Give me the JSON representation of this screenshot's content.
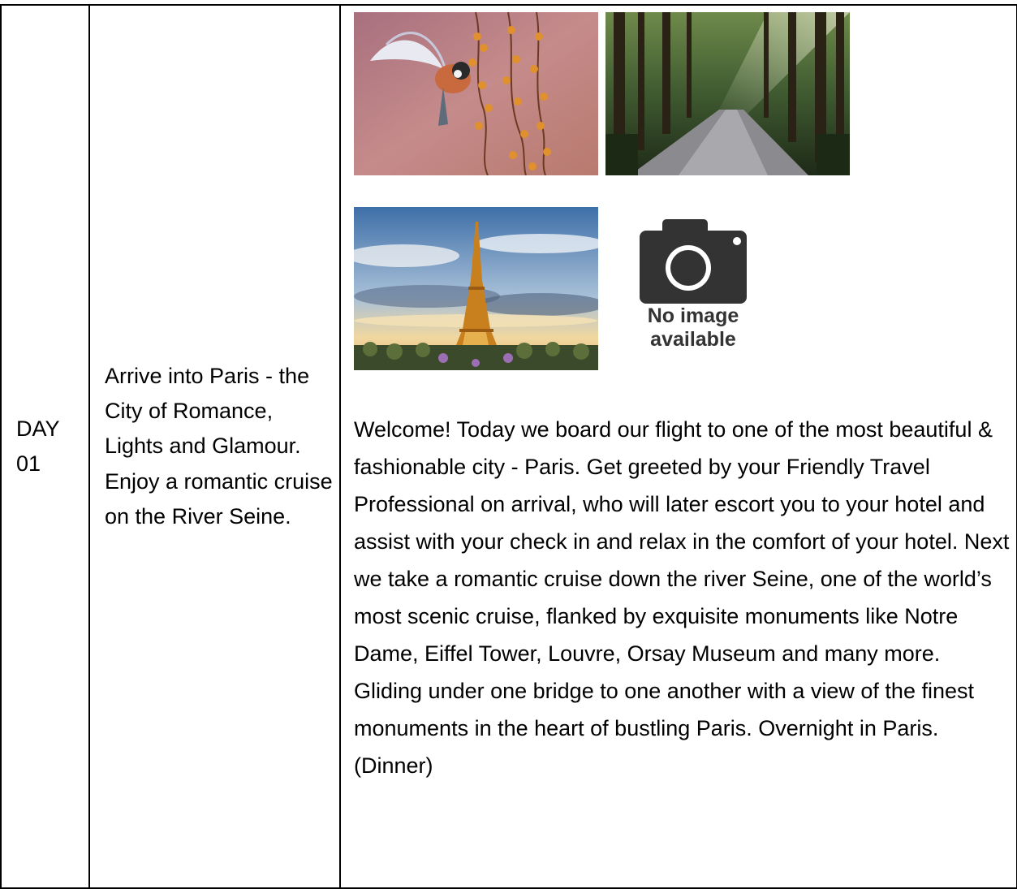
{
  "day": {
    "label": "DAY",
    "number": "01"
  },
  "summary": "Arrive into Paris - the City of Romance, Lights and Glamour. Enjoy a romantic cruise on the River Seine.",
  "images": {
    "bird_icon": "bird-on-branch-photo",
    "forest_icon": "forest-path-photo",
    "eiffel_icon": "eiffel-tower-photo",
    "placeholder_icon": "camera-icon",
    "placeholder_text_line1": "No image",
    "placeholder_text_line2": "available"
  },
  "description": "Welcome! Today we board our flight to one of the most beautiful & fashionable city - Paris. Get greeted by your Friendly Travel Professional on arrival, who will later escort you to your hotel and assist with your check in and relax in the comfort of your hotel. Next we take a romantic cruise down the river Seine, one of the world’s most scenic cruise, flanked by exquisite monuments like Notre Dame, Eiffel Tower, Louvre, Orsay Museum and many more. Gliding under one bridge to one another with a view of the finest monuments in the heart of bustling Paris. Overnight in Paris. (Dinner)",
  "colors": {
    "border": "#000000",
    "placeholder_gray": "#333333"
  }
}
